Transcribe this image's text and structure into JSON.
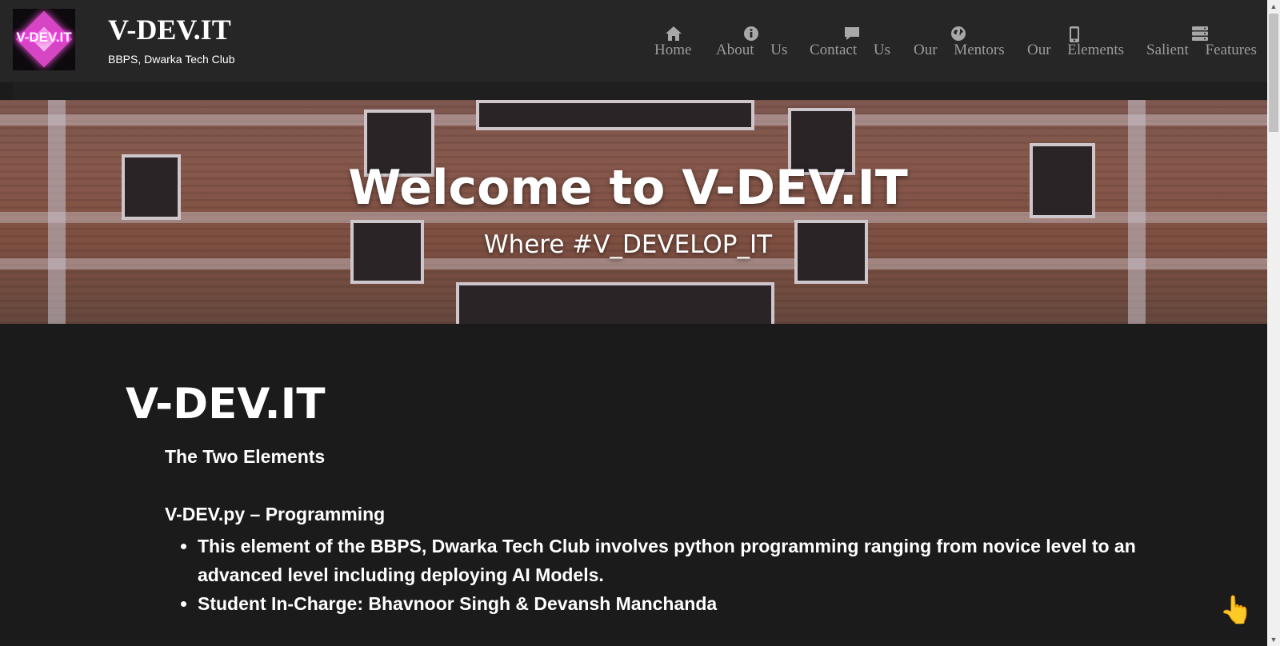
{
  "header": {
    "logo_text": "V-DEV.IT",
    "title": "V-DEV.IT",
    "subtitle": "BBPS, Dwarka Tech Club"
  },
  "nav": [
    {
      "icon": "home-icon",
      "label": "Home"
    },
    {
      "icon": "info-icon",
      "label": "About Us"
    },
    {
      "icon": "chat-icon",
      "label": "Contact Us"
    },
    {
      "icon": "globe-icon",
      "label": "Our Mentors"
    },
    {
      "icon": "mobile-icon",
      "label": "Our Elements"
    },
    {
      "icon": "server-icon",
      "label": "Salient Features"
    }
  ],
  "hero": {
    "title": "Welcome to V-DEV.IT",
    "subtitle": "Where #V_DEVELOP_IT"
  },
  "content": {
    "title": "V-DEV.IT",
    "section_heading": "The Two Elements",
    "element_heading": "V-DEV.py – Programming",
    "bullets": [
      "This element of the BBPS, Dwarka Tech Club involves python programming ranging from novice level to an advanced level including deploying AI Models.",
      "Student In-Charge: Bhavnoor Singh & Devansh Manchanda"
    ]
  },
  "colors": {
    "header_bg": "#262626",
    "page_bg": "#1b1b1b",
    "nav_text": "#9c9c9c",
    "logo_accent": "#d646c4"
  }
}
